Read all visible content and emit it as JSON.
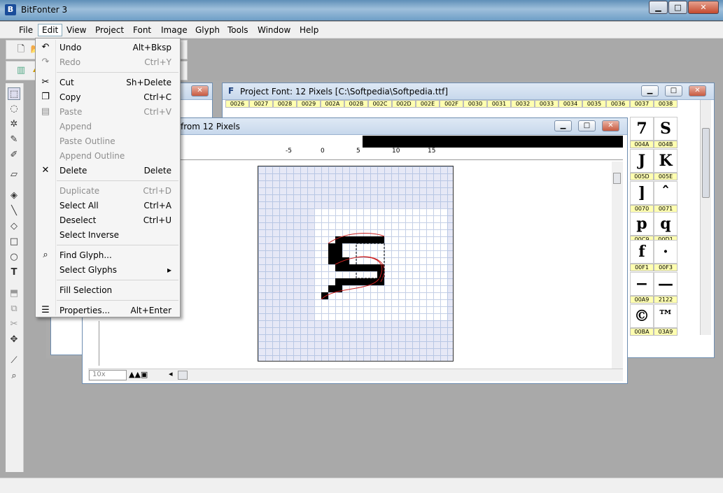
{
  "app": {
    "title": "BitFonter 3",
    "icon_letter": "B"
  },
  "window_buttons": {
    "minimize": "▁",
    "maximize": "□",
    "close": "✕"
  },
  "menubar": [
    "File",
    "Edit",
    "View",
    "Project",
    "Font",
    "Image",
    "Glyph",
    "Tools",
    "Window",
    "Help"
  ],
  "edit_menu": [
    {
      "label": "Undo",
      "shortcut": "Alt+Bksp",
      "icon": "↶",
      "disabled": false
    },
    {
      "label": "Redo",
      "shortcut": "Ctrl+Y",
      "icon": "↷",
      "disabled": true
    },
    {
      "sep": true
    },
    {
      "label": "Cut",
      "shortcut": "Sh+Delete",
      "icon": "✂",
      "disabled": false
    },
    {
      "label": "Copy",
      "shortcut": "Ctrl+C",
      "icon": "❐",
      "disabled": false
    },
    {
      "label": "Paste",
      "shortcut": "Ctrl+V",
      "icon": "▤",
      "disabled": true
    },
    {
      "label": "Append",
      "shortcut": "",
      "icon": "",
      "disabled": true
    },
    {
      "label": "Paste Outline",
      "shortcut": "",
      "icon": "",
      "disabled": true
    },
    {
      "label": "Append Outline",
      "shortcut": "",
      "icon": "",
      "disabled": true
    },
    {
      "label": "Delete",
      "shortcut": "Delete",
      "icon": "✕",
      "disabled": false
    },
    {
      "sep": true
    },
    {
      "label": "Duplicate",
      "shortcut": "Ctrl+D",
      "icon": "",
      "disabled": true
    },
    {
      "label": "Select All",
      "shortcut": "Ctrl+A",
      "icon": "",
      "disabled": false
    },
    {
      "label": "Deselect",
      "shortcut": "Ctrl+U",
      "icon": "",
      "disabled": false
    },
    {
      "label": "Select Inverse",
      "shortcut": "",
      "icon": "",
      "disabled": false
    },
    {
      "sep": true
    },
    {
      "label": "Find Glyph...",
      "shortcut": "",
      "icon": "⌕",
      "disabled": false
    },
    {
      "label": "Select Glyphs",
      "shortcut": "▸",
      "icon": "",
      "disabled": false
    },
    {
      "sep": true
    },
    {
      "label": "Fill Selection",
      "shortcut": "",
      "icon": "",
      "disabled": false
    },
    {
      "sep": true
    },
    {
      "label": "Properties...",
      "shortcut": "Alt+Enter",
      "icon": "☰",
      "disabled": false
    }
  ],
  "project_window": {
    "title": "Project Font: 12 Pixels [C:\\Softpedia\\Softpedia.ttf]",
    "icon": "F",
    "header_codes": [
      "0026",
      "0027",
      "0028",
      "0029",
      "002A",
      "002B",
      "002C",
      "002D",
      "002E",
      "002F",
      "0030",
      "0031",
      "0032",
      "0033",
      "0034",
      "0035",
      "0036",
      "0037",
      "0038"
    ],
    "right_codes": [
      "004A",
      "004B",
      "005D",
      "005E",
      "0070",
      "0071",
      "00C9",
      "00D1",
      "00F1",
      "00F3",
      "00A9",
      "2122",
      "00BA",
      "03A9"
    ],
    "right_glyphs": [
      "7",
      "S",
      "J",
      "K",
      "]",
      "ˆ",
      "p",
      "q",
      "f",
      "·",
      "−",
      "—",
      "©",
      "™"
    ]
  },
  "glyph_window": {
    "title": "from 12 Pixels",
    "ruler_labels": [
      "-5",
      "0",
      "5",
      "10",
      "15"
    ],
    "zoom": "10x"
  },
  "colors": {
    "accent": "#6d8db0",
    "header_cell": "#ffffb0"
  }
}
